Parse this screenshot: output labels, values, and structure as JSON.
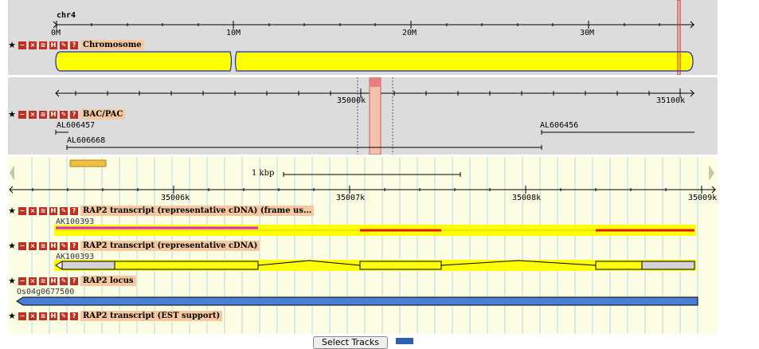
{
  "chromosome_panel": {
    "chrom_name": "chr4",
    "ticks": [
      "0M",
      "10M",
      "20M",
      "30M"
    ],
    "track_label": "Chromosome"
  },
  "bac_panel": {
    "ticks": [
      "35000k",
      "35100k"
    ],
    "track_label": "BAC/PAC",
    "clones": [
      "AL606457",
      "AL606456",
      "AL606668"
    ]
  },
  "detail_panel": {
    "scale_label": "1 kbp",
    "ticks": [
      "35006k",
      "35007k",
      "35008k",
      "35009k"
    ],
    "tracks": [
      {
        "label": "RAP2 transcript (representative cDNA) (frame us...",
        "feature": "AK100393"
      },
      {
        "label": "RAP2 transcript (representative cDNA)",
        "feature": "AK100393"
      },
      {
        "label": "RAP2 locus",
        "feature": "Os04g0677500"
      },
      {
        "label": "RAP2 transcript (EST support)",
        "feature": ""
      }
    ]
  },
  "footer": {
    "select_tracks_button": "Select Tracks"
  },
  "icons": [
    "star-icon",
    "minimize-icon",
    "close-icon",
    "rss-icon",
    "ruler-icon",
    "edit-icon",
    "help-icon"
  ],
  "colors": {
    "panel_gray": "#dcdcdc",
    "detail_bg": "#fdfde4",
    "label_bg": "#f6c8a0",
    "feature_yellow": "#ffff00",
    "red": "#e01818",
    "magenta": "#e020e0",
    "locus_blue": "#4a7fd8"
  }
}
